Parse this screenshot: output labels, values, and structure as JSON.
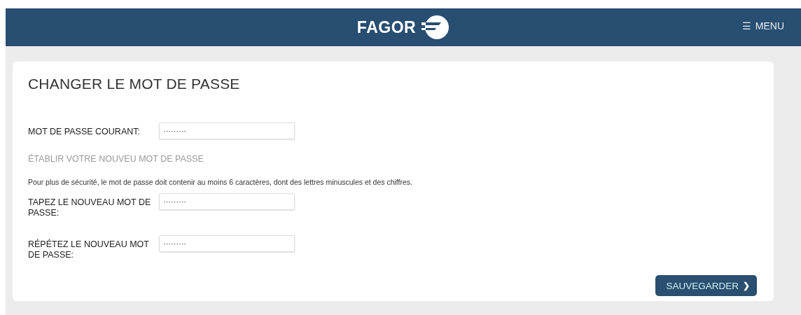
{
  "header": {
    "logo_text": "FAGOR",
    "menu": {
      "icon": "☰",
      "label": "MENU"
    }
  },
  "form": {
    "title": "CHANGER LE MOT DE PASSE",
    "fields": [
      {
        "label": "MOT DE PASSE COURANT:",
        "value": "·········"
      }
    ],
    "section_heading": "ÉTABLIR VOTRE NOUVEU MOT DE PASSE",
    "note": "Pour plus de sécurité, le mot de passe doit contenir au moins 6 caractères, dont des lettres minuscules et des chiffres.",
    "new_fields": [
      {
        "label": "TAPEZ LE NOUVEAU MOT DE PASSE:",
        "value": "·········"
      },
      {
        "label": "RÉPÉTEZ LE NOUVEAU MOT DE PASSE:",
        "value": "·········"
      }
    ],
    "save_button": {
      "label": "SAUVEGARDER",
      "icon": "❯"
    }
  }
}
